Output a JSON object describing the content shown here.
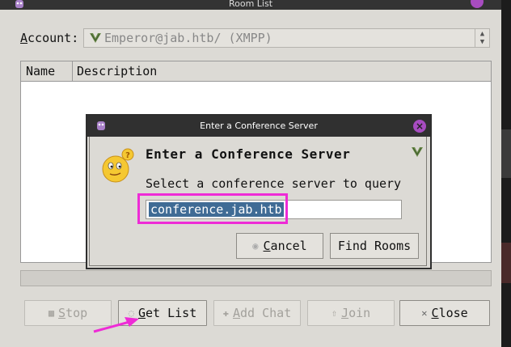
{
  "window": {
    "title": "Room List",
    "account_label_prefix": "",
    "account_label_underlined": "A",
    "account_label_rest": "ccount:",
    "account_value": "Emperor@jab.htb/ (XMPP)",
    "columns": [
      "Name",
      "Description"
    ],
    "buttons": {
      "stop": {
        "underlined": "S",
        "rest": "top"
      },
      "get_list": {
        "underlined": "G",
        "rest": "et List"
      },
      "add_chat": {
        "underlined": "A",
        "rest": "dd Chat"
      },
      "join": {
        "underlined": "J",
        "rest": "oin"
      },
      "close": {
        "underlined": "C",
        "rest": "lose"
      }
    }
  },
  "dialog": {
    "title": "Enter a Conference Server",
    "heading": "Enter a Conference Server",
    "subtext": "Select a conference server to query",
    "input_value": "conference.jab.htb",
    "cancel": {
      "underlined": "C",
      "rest": "ancel"
    },
    "find_rooms": "Find Rooms"
  },
  "annotation_color": "#ee2bd6"
}
